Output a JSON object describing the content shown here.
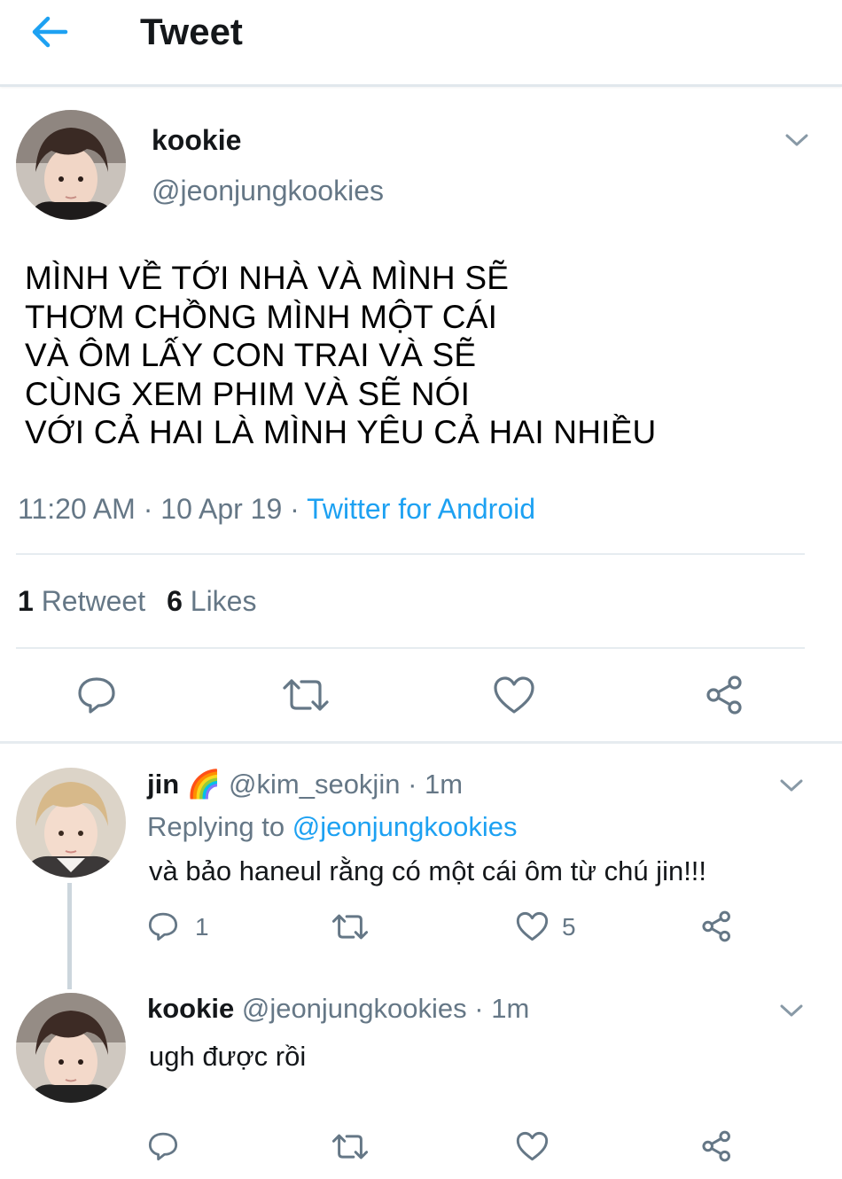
{
  "header": {
    "title": "Tweet"
  },
  "main_tweet": {
    "name": "kookie",
    "handle": "@jeonjungkookies",
    "text": "MÌNH VỀ TỚI NHÀ VÀ MÌNH SẼ\nTHƠM CHỒNG MÌNH MỘT CÁI\nVÀ ÔM LẤY CON TRAI VÀ SẼ\nCÙNG XEM PHIM VÀ SẼ NÓI\nVỚI CẢ HAI LÀ MÌNH YÊU CẢ HAI NHIỀU",
    "time": "11:20 AM",
    "date": "10 Apr 19",
    "source": "Twitter for Android",
    "retweets": "1",
    "retweets_label": "Retweet",
    "likes": "6",
    "likes_label": "Likes"
  },
  "replies": [
    {
      "name": "jin",
      "emoji": "🌈",
      "handle": "@kim_seokjin",
      "time": "1m",
      "replying_prefix": "Replying to",
      "replying_to": "@jeonjungkookies",
      "text": "và bảo haneul rằng có một cái ôm từ chú jin!!!",
      "reply_count": "1",
      "like_count": "5"
    },
    {
      "name": "kookie",
      "handle": "@jeonjungkookies",
      "time": "1m",
      "text": "ugh được rồi"
    }
  ],
  "separator": "·",
  "colors": {
    "accent": "#1da1f2",
    "secondary_text": "#657786",
    "divider": "#e6ecf0"
  },
  "icons": [
    "back-arrow-icon",
    "chevron-down-icon",
    "reply-icon",
    "retweet-icon",
    "like-icon",
    "share-icon"
  ]
}
